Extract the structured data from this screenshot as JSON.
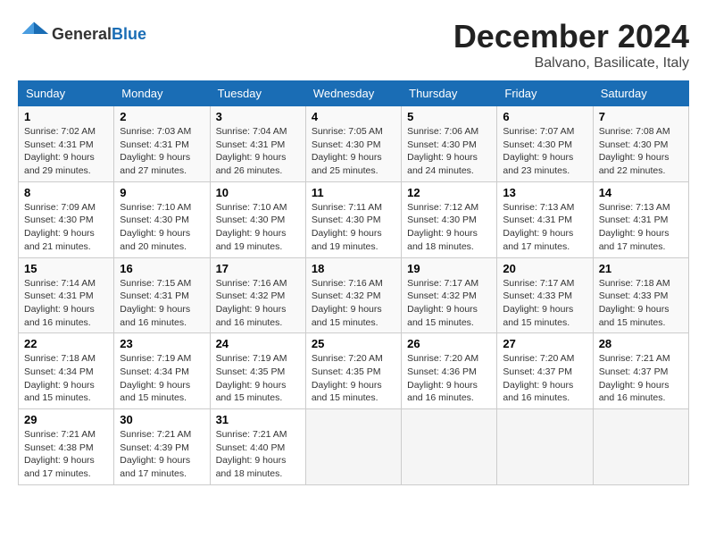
{
  "header": {
    "logo_general": "General",
    "logo_blue": "Blue",
    "month_title": "December 2024",
    "location": "Balvano, Basilicate, Italy"
  },
  "days_of_week": [
    "Sunday",
    "Monday",
    "Tuesday",
    "Wednesday",
    "Thursday",
    "Friday",
    "Saturday"
  ],
  "weeks": [
    [
      {
        "day": "1",
        "sunrise": "7:02 AM",
        "sunset": "4:31 PM",
        "daylight_hours": "9",
        "daylight_minutes": "29"
      },
      {
        "day": "2",
        "sunrise": "7:03 AM",
        "sunset": "4:31 PM",
        "daylight_hours": "9",
        "daylight_minutes": "27"
      },
      {
        "day": "3",
        "sunrise": "7:04 AM",
        "sunset": "4:31 PM",
        "daylight_hours": "9",
        "daylight_minutes": "26"
      },
      {
        "day": "4",
        "sunrise": "7:05 AM",
        "sunset": "4:30 PM",
        "daylight_hours": "9",
        "daylight_minutes": "25"
      },
      {
        "day": "5",
        "sunrise": "7:06 AM",
        "sunset": "4:30 PM",
        "daylight_hours": "9",
        "daylight_minutes": "24"
      },
      {
        "day": "6",
        "sunrise": "7:07 AM",
        "sunset": "4:30 PM",
        "daylight_hours": "9",
        "daylight_minutes": "23"
      },
      {
        "day": "7",
        "sunrise": "7:08 AM",
        "sunset": "4:30 PM",
        "daylight_hours": "9",
        "daylight_minutes": "22"
      }
    ],
    [
      {
        "day": "8",
        "sunrise": "7:09 AM",
        "sunset": "4:30 PM",
        "daylight_hours": "9",
        "daylight_minutes": "21"
      },
      {
        "day": "9",
        "sunrise": "7:10 AM",
        "sunset": "4:30 PM",
        "daylight_hours": "9",
        "daylight_minutes": "20"
      },
      {
        "day": "10",
        "sunrise": "7:10 AM",
        "sunset": "4:30 PM",
        "daylight_hours": "9",
        "daylight_minutes": "19"
      },
      {
        "day": "11",
        "sunrise": "7:11 AM",
        "sunset": "4:30 PM",
        "daylight_hours": "9",
        "daylight_minutes": "19"
      },
      {
        "day": "12",
        "sunrise": "7:12 AM",
        "sunset": "4:30 PM",
        "daylight_hours": "9",
        "daylight_minutes": "18"
      },
      {
        "day": "13",
        "sunrise": "7:13 AM",
        "sunset": "4:31 PM",
        "daylight_hours": "9",
        "daylight_minutes": "17"
      },
      {
        "day": "14",
        "sunrise": "7:13 AM",
        "sunset": "4:31 PM",
        "daylight_hours": "9",
        "daylight_minutes": "17"
      }
    ],
    [
      {
        "day": "15",
        "sunrise": "7:14 AM",
        "sunset": "4:31 PM",
        "daylight_hours": "9",
        "daylight_minutes": "16"
      },
      {
        "day": "16",
        "sunrise": "7:15 AM",
        "sunset": "4:31 PM",
        "daylight_hours": "9",
        "daylight_minutes": "16"
      },
      {
        "day": "17",
        "sunrise": "7:16 AM",
        "sunset": "4:32 PM",
        "daylight_hours": "9",
        "daylight_minutes": "16"
      },
      {
        "day": "18",
        "sunrise": "7:16 AM",
        "sunset": "4:32 PM",
        "daylight_hours": "9",
        "daylight_minutes": "15"
      },
      {
        "day": "19",
        "sunrise": "7:17 AM",
        "sunset": "4:32 PM",
        "daylight_hours": "9",
        "daylight_minutes": "15"
      },
      {
        "day": "20",
        "sunrise": "7:17 AM",
        "sunset": "4:33 PM",
        "daylight_hours": "9",
        "daylight_minutes": "15"
      },
      {
        "day": "21",
        "sunrise": "7:18 AM",
        "sunset": "4:33 PM",
        "daylight_hours": "9",
        "daylight_minutes": "15"
      }
    ],
    [
      {
        "day": "22",
        "sunrise": "7:18 AM",
        "sunset": "4:34 PM",
        "daylight_hours": "9",
        "daylight_minutes": "15"
      },
      {
        "day": "23",
        "sunrise": "7:19 AM",
        "sunset": "4:34 PM",
        "daylight_hours": "9",
        "daylight_minutes": "15"
      },
      {
        "day": "24",
        "sunrise": "7:19 AM",
        "sunset": "4:35 PM",
        "daylight_hours": "9",
        "daylight_minutes": "15"
      },
      {
        "day": "25",
        "sunrise": "7:20 AM",
        "sunset": "4:35 PM",
        "daylight_hours": "9",
        "daylight_minutes": "15"
      },
      {
        "day": "26",
        "sunrise": "7:20 AM",
        "sunset": "4:36 PM",
        "daylight_hours": "9",
        "daylight_minutes": "16"
      },
      {
        "day": "27",
        "sunrise": "7:20 AM",
        "sunset": "4:37 PM",
        "daylight_hours": "9",
        "daylight_minutes": "16"
      },
      {
        "day": "28",
        "sunrise": "7:21 AM",
        "sunset": "4:37 PM",
        "daylight_hours": "9",
        "daylight_minutes": "16"
      }
    ],
    [
      {
        "day": "29",
        "sunrise": "7:21 AM",
        "sunset": "4:38 PM",
        "daylight_hours": "9",
        "daylight_minutes": "17"
      },
      {
        "day": "30",
        "sunrise": "7:21 AM",
        "sunset": "4:39 PM",
        "daylight_hours": "9",
        "daylight_minutes": "17"
      },
      {
        "day": "31",
        "sunrise": "7:21 AM",
        "sunset": "4:40 PM",
        "daylight_hours": "9",
        "daylight_minutes": "18"
      },
      null,
      null,
      null,
      null
    ]
  ],
  "labels": {
    "sunrise": "Sunrise:",
    "sunset": "Sunset:",
    "daylight": "Daylight:",
    "hours_label": "hours",
    "and_label": "and",
    "minutes_label": "minutes."
  },
  "colors": {
    "header_bg": "#1a6db5",
    "accent": "#1a6db5"
  }
}
